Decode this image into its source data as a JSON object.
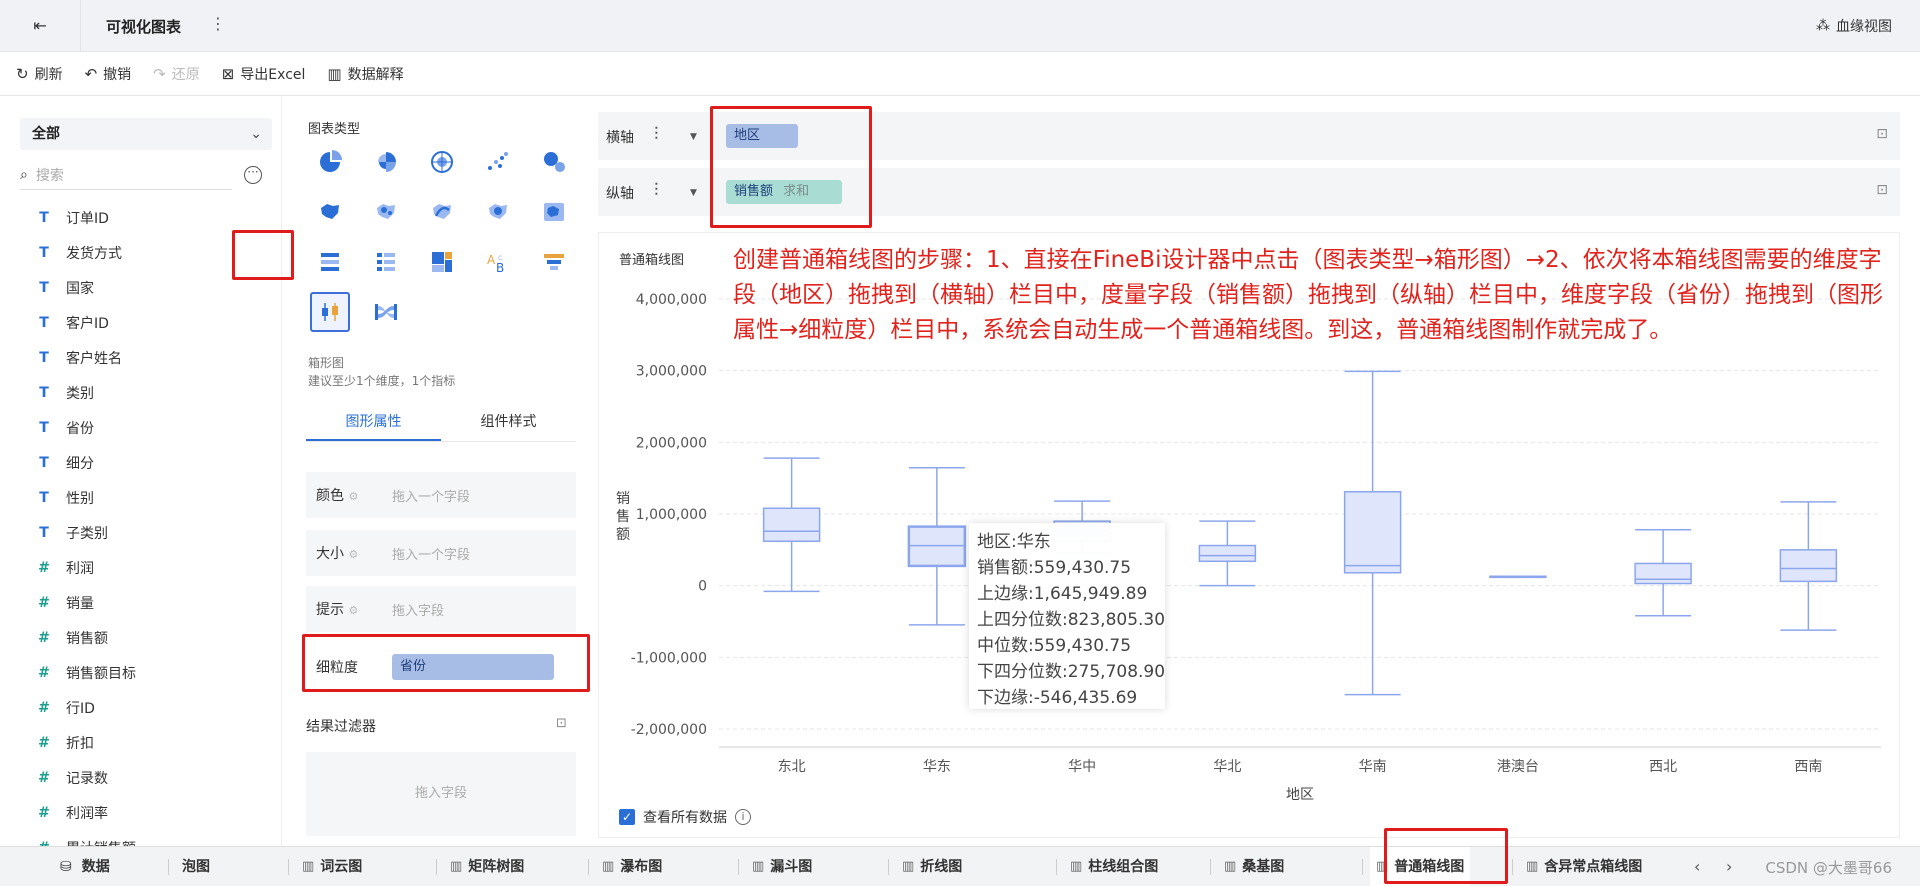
{
  "header": {
    "back_icon": "exit-icon",
    "title": "可视化图表",
    "more": "⋮",
    "lineage_label": "血缘视图"
  },
  "toolbar": {
    "refresh": "刷新",
    "undo": "撤销",
    "redo": "还原",
    "export": "导出Excel",
    "explain": "数据解释"
  },
  "data_panel": {
    "scope": "全部",
    "search_placeholder": "搜索",
    "fields": [
      {
        "type": "T",
        "name": "订单ID"
      },
      {
        "type": "T",
        "name": "发货方式"
      },
      {
        "type": "T",
        "name": "国家"
      },
      {
        "type": "T",
        "name": "客户ID"
      },
      {
        "type": "T",
        "name": "客户姓名"
      },
      {
        "type": "T",
        "name": "类别"
      },
      {
        "type": "T",
        "name": "省份"
      },
      {
        "type": "T",
        "name": "细分"
      },
      {
        "type": "T",
        "name": "性别"
      },
      {
        "type": "T",
        "name": "子类别"
      },
      {
        "type": "#",
        "name": "利润"
      },
      {
        "type": "#",
        "name": "销量"
      },
      {
        "type": "#",
        "name": "销售额"
      },
      {
        "type": "#",
        "name": "销售额目标"
      },
      {
        "type": "#",
        "name": "行ID"
      },
      {
        "type": "#",
        "name": "折扣"
      },
      {
        "type": "#",
        "name": "记录数"
      },
      {
        "type": "%",
        "name": "利润率"
      },
      {
        "type": "#",
        "name": "累计销售额"
      }
    ]
  },
  "config_panel": {
    "chart_type_label": "图表类型",
    "chart_desc_title": "箱形图",
    "chart_desc_hint": "建议至少1个维度，1个指标",
    "tabs": [
      "图形属性",
      "组件样式"
    ],
    "attributes": [
      {
        "label": "颜色",
        "placeholder": "拖入一个字段"
      },
      {
        "label": "大小",
        "placeholder": "拖入一个字段"
      },
      {
        "label": "提示",
        "placeholder": "拖入字段"
      },
      {
        "label": "细粒度",
        "value": "省份"
      }
    ],
    "filter_label": "结果过滤器",
    "filter_placeholder": "拖入字段"
  },
  "shelves": {
    "x_label": "横轴",
    "x_field": "地区",
    "y_label": "纵轴",
    "y_field": "销售额",
    "y_agg": "求和"
  },
  "chart_area": {
    "title": "普通箱线图",
    "annotation": "创建普通箱线图的步骤：1、直接在FineBi设计器中点击（图表类型→箱形图）→2、依次将本箱线图需要的维度字段（地区）拖拽到（横轴）栏目中，度量字段（销售额）拖拽到（纵轴）栏目中，维度字段（省份）拖拽到（图形属性→细粒度）栏目中，系统会自动生成一个普通箱线图。到这，普通箱线图制作就完成了。",
    "view_all_label": "查看所有数据",
    "tooltip": [
      "地区:华东",
      "销售额:559,430.75",
      "上边缘:1,645,949.89",
      "上四分位数:823,805.30",
      "中位数:559,430.75",
      "下四分位数:275,708.90",
      "下边缘:-546,435.69"
    ]
  },
  "chart_data": {
    "type": "boxplot",
    "xlabel": "地区",
    "ylabel": "销售额",
    "ylim": [
      -2000000,
      4000000
    ],
    "yticks": [
      4000000,
      3000000,
      2000000,
      1000000,
      0,
      -1000000,
      -2000000
    ],
    "ytick_labels": [
      "4,000,000",
      "3,000,000",
      "2,000,000",
      "1,000,000",
      "0",
      "-1,000,000",
      "-2,000,000"
    ],
    "categories": [
      "东北",
      "华东",
      "华中",
      "华北",
      "华南",
      "港澳台",
      "西北",
      "西南"
    ],
    "boxes": [
      {
        "low": -80000,
        "q1": 620000,
        "median": 760000,
        "q3": 1080000,
        "high": 1780000
      },
      {
        "low": -546435.69,
        "q1": 275708.9,
        "median": 559430.75,
        "q3": 823805.3,
        "high": 1645949.89
      },
      {
        "low": 450000,
        "q1": 620000,
        "median": 760000,
        "q3": 900000,
        "high": 1180000
      },
      {
        "low": 0,
        "q1": 340000,
        "median": 420000,
        "q3": 560000,
        "high": 900000
      },
      {
        "low": -1520000,
        "q1": 180000,
        "median": 280000,
        "q3": 1310000,
        "high": 2990000
      },
      {
        "low": 130000,
        "q1": 130000,
        "median": 130000,
        "q3": 130000,
        "high": 130000
      },
      {
        "low": -420000,
        "q1": 30000,
        "median": 90000,
        "q3": 310000,
        "high": 780000
      },
      {
        "low": -620000,
        "q1": 60000,
        "median": 240000,
        "q3": 500000,
        "high": 1170000
      }
    ],
    "colors": {
      "box_fill": "#dfe6fb",
      "box_stroke": "#8ba6ec",
      "grid": "#e6e6e6"
    }
  },
  "bottom_tabs": {
    "data_tab": "数据",
    "sheets": [
      "泡图",
      "词云图",
      "矩阵树图",
      "瀑布图",
      "漏斗图",
      "折线图",
      "柱线组合图",
      "桑基图",
      "普通箱线图",
      "含异常点箱线图"
    ],
    "active": "普通箱线图",
    "watermark": "CSDN @大墨哥66"
  }
}
